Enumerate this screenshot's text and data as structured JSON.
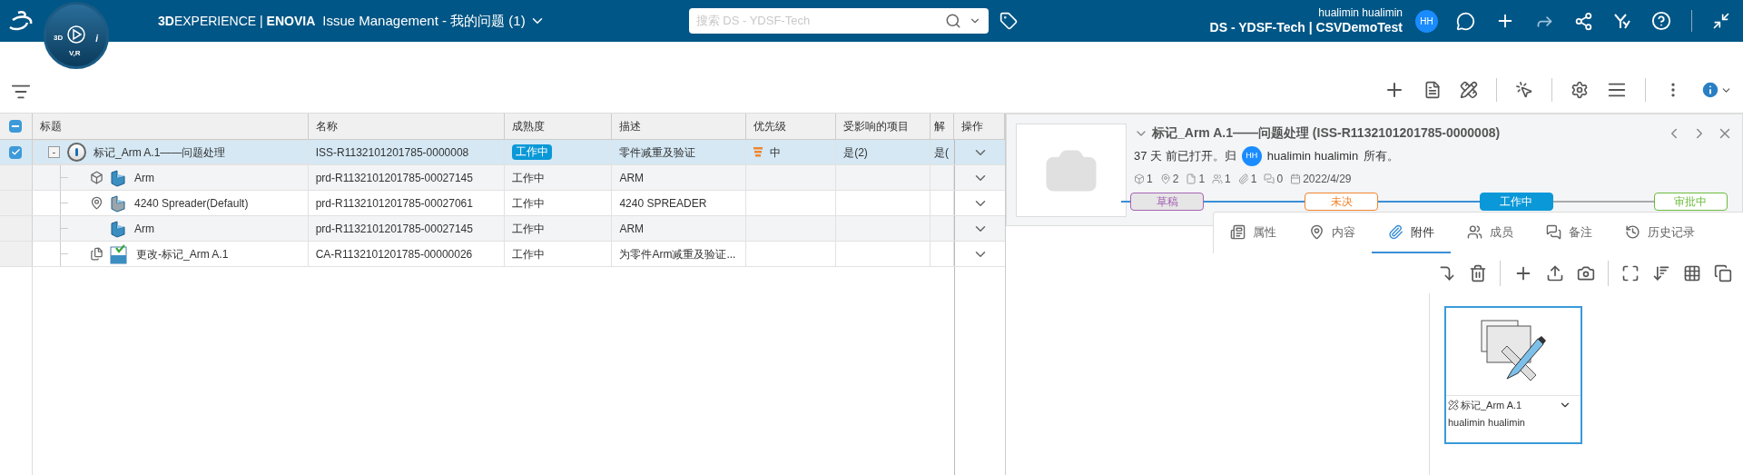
{
  "top_bar": {
    "brand_bold": "3D",
    "brand": "EXPERIENCE",
    "separator": "|",
    "product": "ENOVIA",
    "app_title": "Issue Management - 我的问题 (1)",
    "compass_labels": [
      "3D",
      "V,R",
      "i"
    ],
    "search": {
      "placeholder": "搜索 DS - YDSF-Tech"
    },
    "user_name": "hualimin hualimin",
    "tenant": "DS - YDSF-Tech | CSVDemoTest",
    "avatar": "HH"
  },
  "table": {
    "select_all_partial": true,
    "columns": [
      "标题",
      "名称",
      "成熟度",
      "描述",
      "优先级",
      "受影响的项目",
      "解",
      "操作"
    ],
    "rows": [
      {
        "title": "标记_Arm A.1——问题处理",
        "name": "ISS-R1132101201785-0000008",
        "maturity": "工作中",
        "description": "零件减重及验证",
        "priority": "中",
        "affected": "是(2)",
        "column_7": "是(",
        "selected": true,
        "checked": true,
        "expanded": true,
        "toggle": "-",
        "children": [
          {
            "kind": "affected",
            "title": "Arm",
            "name": "prd-R1132101201785-00027145",
            "maturity": "工作中",
            "description": "ARM",
            "selected": false,
            "checked": false
          },
          {
            "kind": "context",
            "title": "4240 Spreader(Default)",
            "name": "prd-R1132101201785-00027061",
            "maturity": "工作中",
            "description": "4240 SPREADER",
            "selected": false,
            "checked": false
          },
          {
            "kind": "plain",
            "title": "Arm",
            "name": "prd-R1132101201785-00027145",
            "maturity": "工作中",
            "description": "ARM",
            "selected": false,
            "checked": false
          },
          {
            "kind": "change",
            "title": "更改-标记_Arm A.1",
            "name": "CA-R1132101201785-00000026",
            "maturity": "工作中",
            "description": "为零件Arm减重及验证...",
            "selected": false,
            "checked": false
          }
        ]
      }
    ]
  },
  "detail": {
    "title": "标记_Arm A.1——问题处理 (ISS-R1132101201785-0000008)",
    "opened": "37 天 前已打开。归",
    "owner_avatar": "HH",
    "owner": "hualimin hualimin",
    "owned_suffix": "所有。",
    "stats": [
      {
        "kind": "parts",
        "value": "1"
      },
      {
        "kind": "locations",
        "value": "2"
      },
      {
        "kind": "documents",
        "value": "1"
      },
      {
        "kind": "members",
        "value": "1"
      },
      {
        "kind": "attachments",
        "value": "1"
      },
      {
        "kind": "comments",
        "value": "0"
      },
      {
        "kind": "date",
        "value": "2022/4/29"
      }
    ],
    "lifecycle": [
      {
        "label": "草稿",
        "color": "#a464b4",
        "selected": false
      },
      {
        "label": "未决",
        "color": "#f0862e",
        "selected": false
      },
      {
        "label": "工作中",
        "color": "#0a98d8",
        "selected": true
      },
      {
        "label": "审批中",
        "color": "#6cbb3c",
        "selected": false
      }
    ],
    "tabs": [
      {
        "kind": "properties",
        "label": "属性",
        "selected": false
      },
      {
        "kind": "content",
        "label": "内容",
        "selected": false
      },
      {
        "kind": "attachments",
        "label": "附件",
        "selected": true
      },
      {
        "kind": "members",
        "label": "成员",
        "selected": false
      },
      {
        "kind": "notes",
        "label": "备注",
        "selected": false
      },
      {
        "kind": "history",
        "label": "历史记录",
        "selected": false
      }
    ],
    "attachments": [
      {
        "title": "标记_Arm A.1",
        "owner": "hualimin hualimin",
        "selected": true
      }
    ]
  }
}
